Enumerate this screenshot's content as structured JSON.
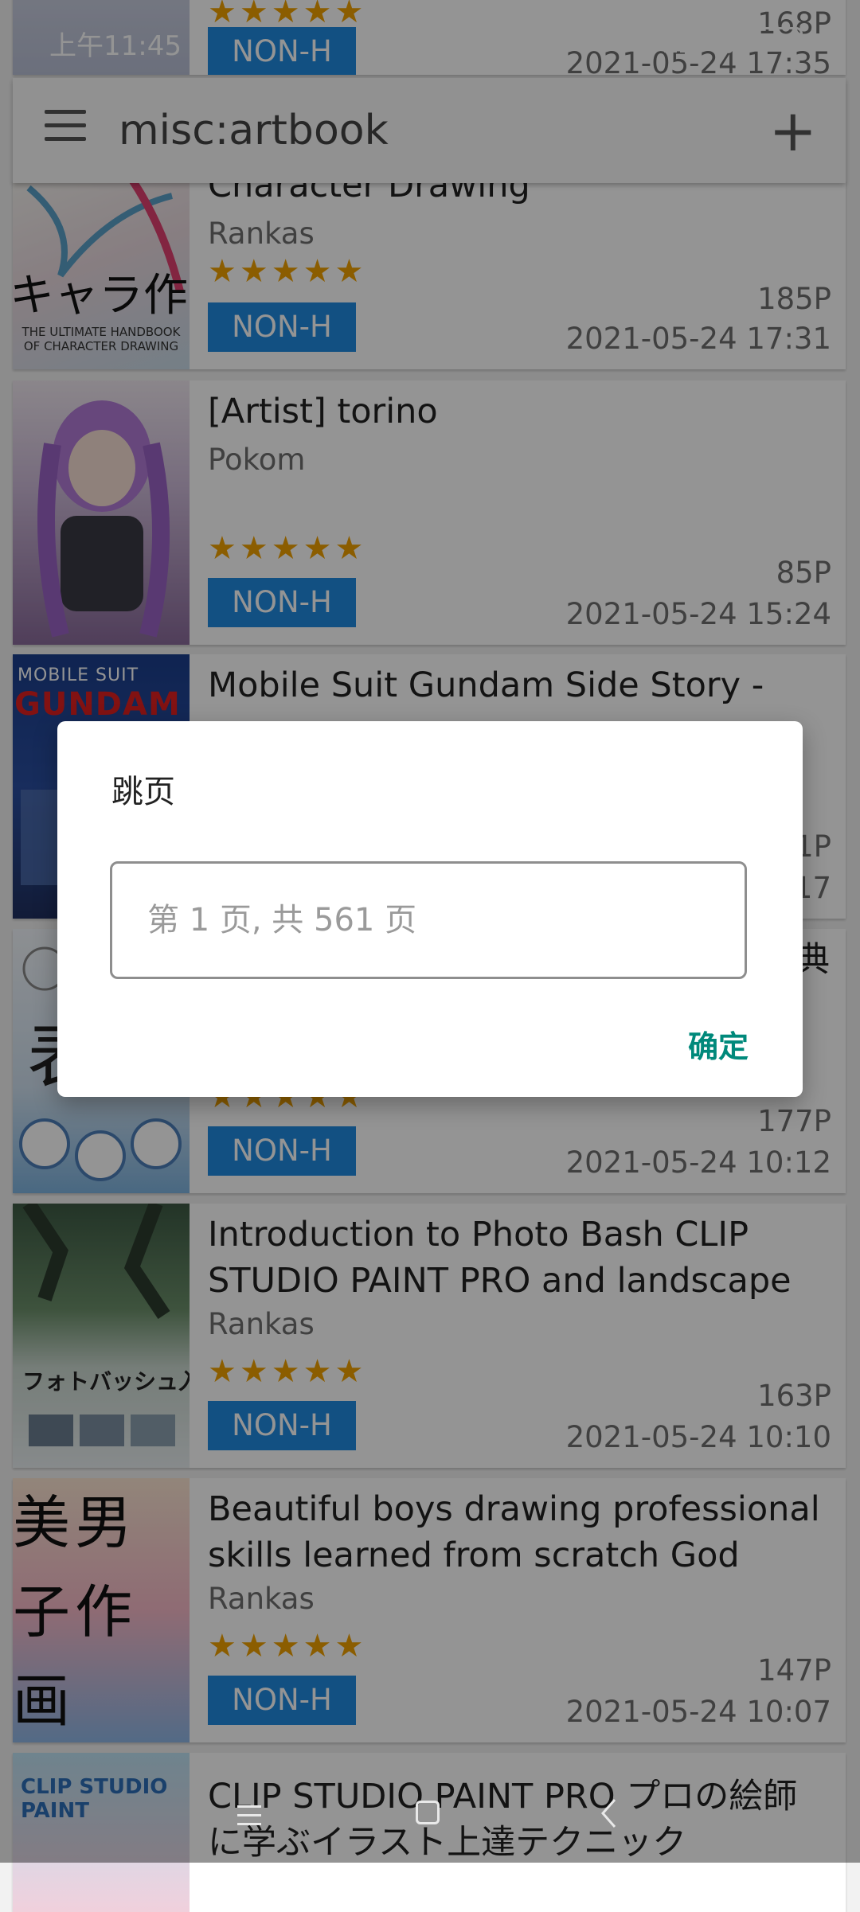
{
  "status_bar": {
    "time": "上午11:45",
    "battery": "93"
  },
  "toolbar": {
    "title": "misc:artbook",
    "add_label": "+"
  },
  "gallery": [
    {
      "title": "",
      "uploader": "",
      "category": "NON-H",
      "pages": "168P",
      "date": "2021-05-24 17:35"
    },
    {
      "title": "Character Drawing",
      "uploader": "Rankas",
      "category": "NON-H",
      "pages": "185P",
      "date": "2021-05-24 17:31",
      "thumb_text": "キャラ作画",
      "thumb_sub": "THE ULTIMATE HANDBOOK OF CHARACTER DRAWING"
    },
    {
      "title": "[Artist] torino",
      "uploader": "Pokom",
      "category": "NON-H",
      "pages": "85P",
      "date": "2021-05-24 15:24"
    },
    {
      "title": "Mobile Suit Gundam Side Story - The",
      "thumb_text": "GUNDAM",
      "thumb_sub": "MOBILE SUIT",
      "pages_partial": "1P",
      "date_partial": "17"
    },
    {
      "title_partial": "典",
      "category": "NON-H",
      "pages": "177P",
      "date": "2021-05-24 10:12"
    },
    {
      "title": "Introduction to Photo Bash CLIP STUDIO PAINT PRO and landscape …",
      "uploader": "Rankas",
      "category": "NON-H",
      "pages": "163P",
      "date": "2021-05-24 10:10",
      "thumb_text": "フォトバッシュ入門"
    },
    {
      "title": "Beautiful boys drawing professional skills learned from scratch God skill…",
      "uploader": "Rankas",
      "category": "NON-H",
      "pages": "147P",
      "date": "2021-05-24 10:07",
      "thumb_text": "美男子作画"
    },
    {
      "title": "CLIP STUDIO PAINT PRO プロの絵師に学ぶイラスト上達テクニック",
      "thumb_text": "CLIP STUDIO PAINT"
    }
  ],
  "stars": "★★★★★",
  "dialog": {
    "title": "跳页",
    "input_placeholder": "第 1 页, 共 561 页",
    "confirm_label": "确定"
  },
  "nav_bar": {
    "menu_icon": "menu-icon",
    "home_icon": "home-icon",
    "back_icon": "back-icon"
  }
}
